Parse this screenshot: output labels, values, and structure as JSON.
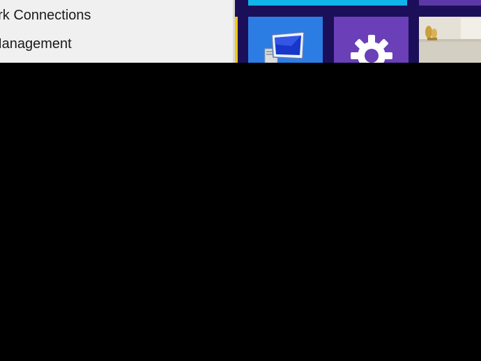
{
  "context_menu": {
    "items": [
      {
        "label": "ork Connections"
      },
      {
        "label": "Management"
      }
    ]
  },
  "start_screen": {
    "background_color": "#1c0f5a",
    "tiles": [
      {
        "icon": "desktop-computer-icon",
        "color": "#2b7de4"
      },
      {
        "icon": "gear-icon",
        "color": "#6a3fb8"
      },
      {
        "icon": "photo-thumbnail",
        "color": "#e6e1d6"
      }
    ]
  }
}
